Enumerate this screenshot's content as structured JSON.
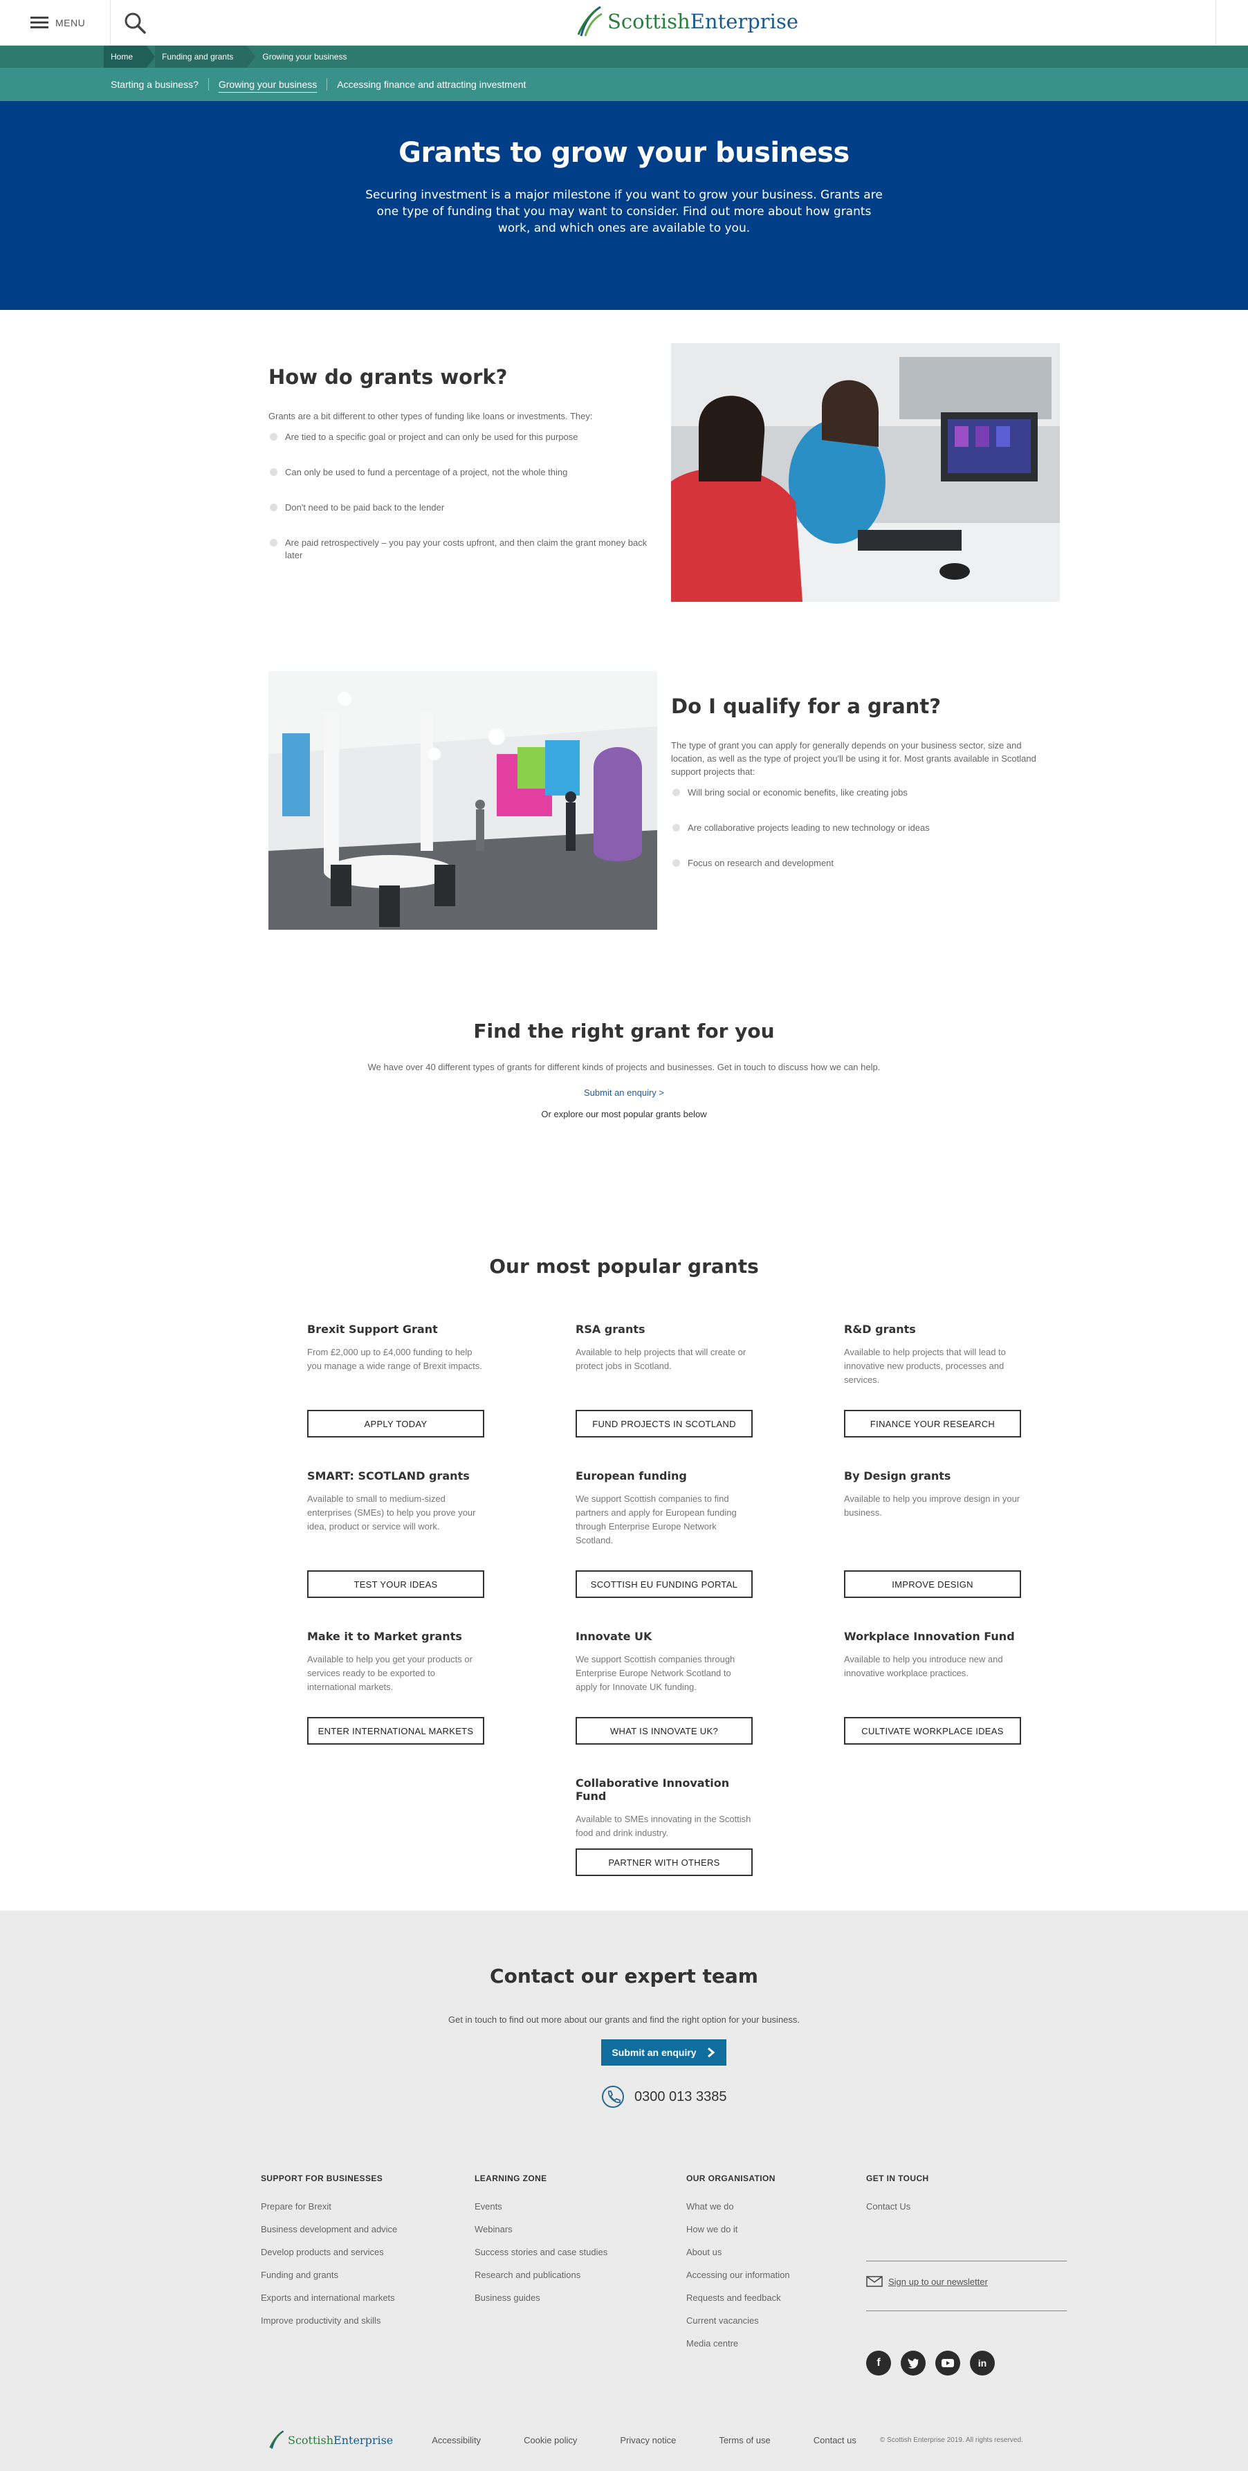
{
  "header": {
    "menu_label": "MENU",
    "logo_word1": "Scottish",
    "logo_word2": "Enterprise"
  },
  "breadcrumb": [
    "Home",
    "Funding and grants",
    "Growing your business"
  ],
  "subnav": [
    "Starting a business?",
    "Growing your business",
    "Accessing finance and attracting investment"
  ],
  "hero": {
    "title": "Grants to grow your business",
    "text": "Securing investment is a major milestone if you want to grow your business. Grants are one type of funding that you may want to consider. Find out more about how grants work, and which ones are available to you."
  },
  "how": {
    "title": "How do grants work?",
    "intro": "Grants are a bit different to other types of funding like loans or investments. They:",
    "bullets": [
      "Are tied to a specific goal or project and can only be used for this purpose",
      "Can only be used to fund a percentage of a project, not the whole thing",
      "Don't need to be paid back to the lender",
      "Are paid retrospectively – you pay your costs upfront, and then claim the grant money back later"
    ]
  },
  "qualify": {
    "title": "Do I qualify for a grant?",
    "intro": "The type of grant you can apply for generally depends on your business sector, size and location, as well as the type of project you'll be using it for. Most grants available in Scotland support projects that:",
    "bullets": [
      "Will bring social or economic benefits, like creating jobs",
      "Are collaborative projects leading to new technology or ideas",
      "Focus on research and development"
    ]
  },
  "find": {
    "title": "Find the right grant for you",
    "text": "We have over 40 different types of grants for different kinds of projects and businesses. Get in touch to discuss how we can help.",
    "link": "Submit an enquiry >",
    "explore": "Or explore our most popular grants below"
  },
  "popular": {
    "title": "Our most popular grants",
    "grants": [
      {
        "title": "Brexit Support Grant",
        "text": "From £2,000 up to £4,000 funding to help you manage a wide range of Brexit impacts.",
        "button": "APPLY TODAY"
      },
      {
        "title": "RSA grants",
        "text": "Available to help projects that will create or protect jobs in Scotland.",
        "button": "FUND PROJECTS IN SCOTLAND"
      },
      {
        "title": "R&D grants",
        "text": "Available to help projects that will lead to innovative new products, processes and services.",
        "button": "FINANCE YOUR RESEARCH"
      },
      {
        "title": "SMART: SCOTLAND grants",
        "text": "Available to small to medium-sized enterprises (SMEs) to help you prove your idea, product or service will work.",
        "button": "TEST YOUR IDEAS"
      },
      {
        "title": "European funding",
        "text": "We support Scottish companies to find partners and apply for European funding through Enterprise Europe Network Scotland.",
        "button": "SCOTTISH EU FUNDING PORTAL"
      },
      {
        "title": "By Design grants",
        "text": "Available to help you improve design in your business.",
        "button": "IMPROVE DESIGN"
      },
      {
        "title": "Make it to Market grants",
        "text": "Available to help you get your products or services ready to be exported to international markets.",
        "button": "ENTER INTERNATIONAL MARKETS"
      },
      {
        "title": "Innovate UK",
        "text": "We support Scottish companies through Enterprise Europe Network Scotland to apply for Innovate UK funding.",
        "button": "WHAT IS INNOVATE UK?"
      },
      {
        "title": "Workplace Innovation Fund",
        "text": "Available to help you introduce new and innovative workplace practices.",
        "button": "CULTIVATE WORKPLACE IDEAS"
      },
      {
        "title": "Collaborative Innovation Fund",
        "text": "Available to SMEs innovating in the Scottish food and drink industry.",
        "button": "PARTNER WITH OTHERS"
      }
    ]
  },
  "contact": {
    "title": "Contact our expert team",
    "text": "Get in touch to find out more about our grants and find the right option for your business.",
    "button": "Submit an enquiry",
    "phone": "0300 013 3385"
  },
  "footer": {
    "support": {
      "heading": "SUPPORT FOR BUSINESSES",
      "links": [
        "Prepare for Brexit",
        "Business development and advice",
        "Develop products and services",
        "Funding and grants",
        "Exports and international markets",
        "Improve productivity and skills"
      ]
    },
    "learning": {
      "heading": "LEARNING ZONE",
      "links": [
        "Events",
        "Webinars",
        "Success stories and case studies",
        "Research and publications",
        "Business guides"
      ]
    },
    "organisation": {
      "heading": "OUR ORGANISATION",
      "links": [
        "What we do",
        "How we do it",
        "About us",
        "Accessing our information",
        "Requests and feedback",
        "Current vacancies",
        "Media centre"
      ]
    },
    "touch": {
      "heading": "GET IN TOUCH",
      "contact": "Contact Us",
      "newsletter": "Sign up to our newsletter"
    },
    "socials": [
      "facebook-icon",
      "twitter-icon",
      "youtube-icon",
      "linkedin-icon"
    ],
    "bottom_links": [
      "Accessibility",
      "Cookie policy",
      "Privacy notice",
      "Terms of use",
      "Contact us"
    ],
    "copyright": "© Scottish Enterprise 2019. All rights reserved."
  }
}
